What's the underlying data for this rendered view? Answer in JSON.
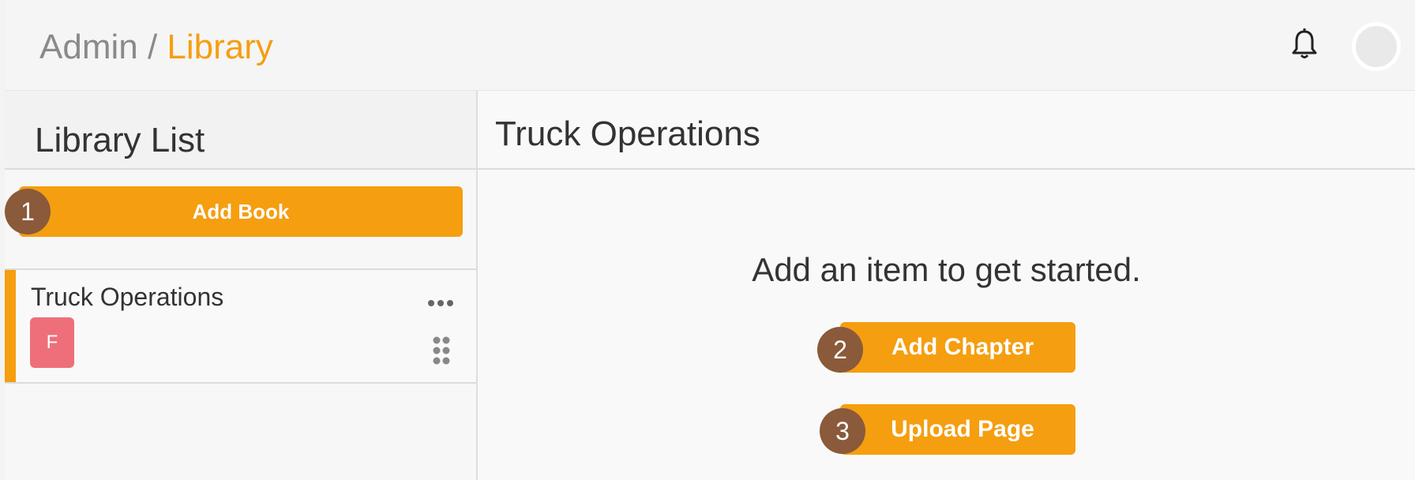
{
  "header": {
    "breadcrumb": {
      "root": "Admin",
      "separator": " / ",
      "current": "Library"
    }
  },
  "icons": {
    "bell": "bell-icon",
    "more": "more-horizontal-icon",
    "drag": "drag-handle-icon"
  },
  "colors": {
    "accent": "#f59e10",
    "step_badge": "#8a5a3a",
    "book_badge": "#ee6f7a"
  },
  "left_panel": {
    "title": "Library List",
    "add_book_label": "Add Book",
    "books": [
      {
        "title": "Truck Operations",
        "badge": "F"
      }
    ]
  },
  "right_panel": {
    "title": "Truck Operations",
    "empty_message": "Add an item to get started.",
    "add_chapter_label": "Add Chapter",
    "upload_page_label": "Upload Page"
  },
  "steps": [
    "1",
    "2",
    "3"
  ]
}
